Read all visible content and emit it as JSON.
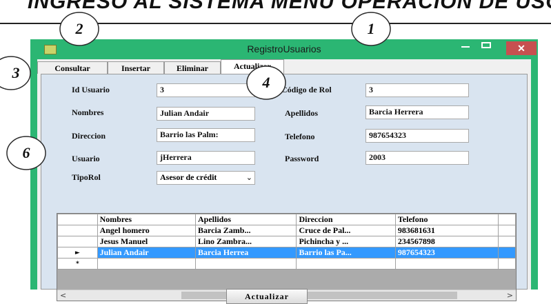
{
  "document": {
    "heading": "INGRESO AL SISTEMA MENÚ OPERACIÓN DE USO"
  },
  "window": {
    "title": "RegistroUsuarios",
    "close_glyph": "✕"
  },
  "tabs": [
    {
      "label": "Consultar"
    },
    {
      "label": "Insertar"
    },
    {
      "label": "Eliminar"
    },
    {
      "label": "Actualizar"
    }
  ],
  "form": {
    "id_usuario": {
      "label": "Id Usuario",
      "value": "3"
    },
    "codigo_rol": {
      "label": "Código de Rol",
      "value": "3"
    },
    "nombres": {
      "label": "Nombres",
      "value": "Julian Andair"
    },
    "apellidos": {
      "label": "Apellidos",
      "value": "Barcia Herrera"
    },
    "direccion": {
      "label": "Direccion",
      "value": "Barrio las Palm:"
    },
    "telefono": {
      "label": "Telefono",
      "value": "987654323"
    },
    "usuario": {
      "label": "Usuario",
      "value": "jHerrera"
    },
    "password": {
      "label": "Password",
      "value": "2003"
    },
    "tiporol": {
      "label": "TipoRol",
      "value": "Asesor de crédit"
    }
  },
  "grid": {
    "columns": [
      "Nombres",
      "Apellidos",
      "Direccion",
      "Telefono"
    ],
    "rows": [
      {
        "marker": "",
        "cells": [
          "Angel homero",
          "Barcia Zamb...",
          "Cruce de Pal...",
          "983681631"
        ]
      },
      {
        "marker": "",
        "cells": [
          "Jesus Manuel",
          "Lino Zambra...",
          "Pichincha y ...",
          "234567898"
        ]
      },
      {
        "marker": "►",
        "cells": [
          "Julian Andair",
          "Barcia Herrea",
          "Barrio las Pa...",
          "987654323"
        ]
      },
      {
        "marker": "*",
        "cells": [
          "",
          "",
          "",
          ""
        ]
      }
    ],
    "scroll_left": "<",
    "scroll_right": ">"
  },
  "buttons": {
    "update_label": "Actualizar"
  },
  "callouts": {
    "c1": "1",
    "c2": "2",
    "c3": "3",
    "c4": "4",
    "c6": "6"
  },
  "colors": {
    "window_frame": "#2bb673",
    "selection": "#3399ff",
    "close_button": "#c75050"
  }
}
